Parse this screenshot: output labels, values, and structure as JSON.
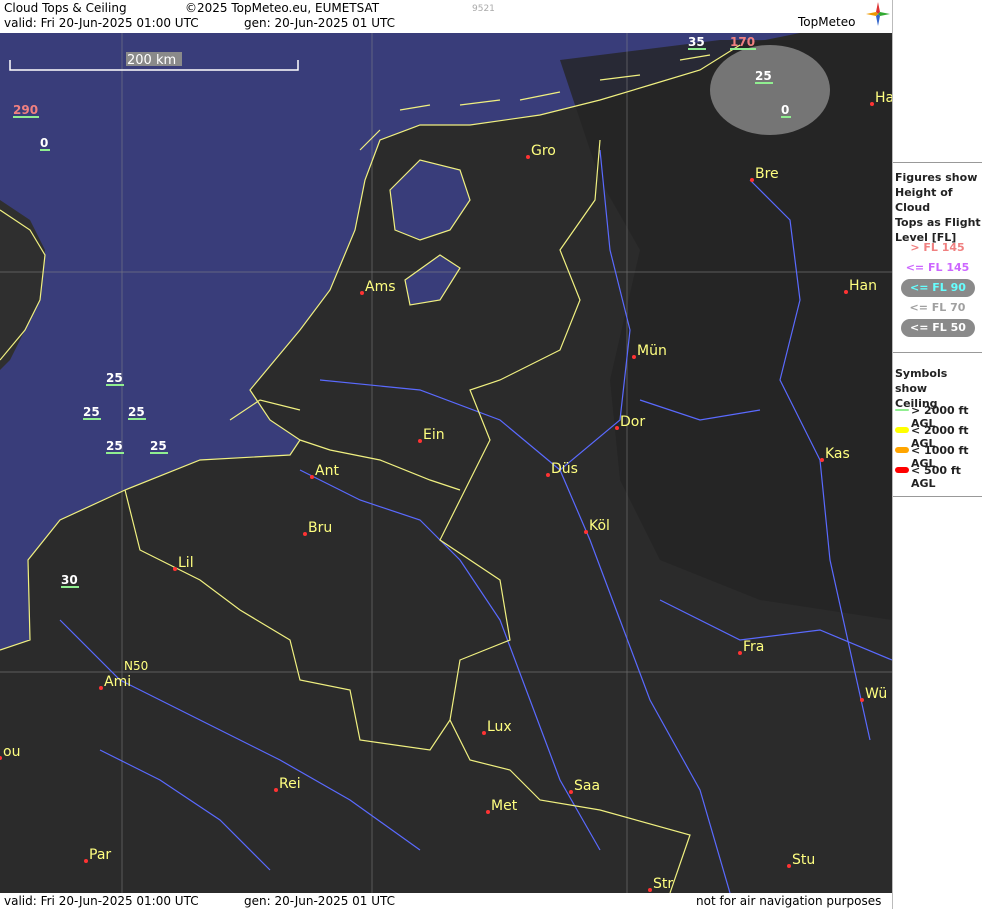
{
  "header": {
    "title": "Cloud Tops & Ceiling",
    "copyright": "©2025 TopMeteo.eu, EUMETSAT",
    "code": "9521",
    "valid": "valid:  Fri  20-Jun-2025  01:00 UTC",
    "gen": "gen: 20-Jun-2025 01 UTC",
    "logo": "TopMeteo"
  },
  "footer": {
    "valid": "valid:  Fri  20-Jun-2025  01:00 UTC",
    "gen": "gen: 20-Jun-2025 01 UTC",
    "disclaimer": "not for air navigation purposes"
  },
  "scale_bar": {
    "label": "200 km"
  },
  "grid_label": "N50",
  "cities": [
    {
      "name": "Gro"
    },
    {
      "name": "Bre"
    },
    {
      "name": "Ha"
    },
    {
      "name": "Ams"
    },
    {
      "name": "Han"
    },
    {
      "name": "Mün"
    },
    {
      "name": "Dor"
    },
    {
      "name": "Ein"
    },
    {
      "name": "Ant"
    },
    {
      "name": "Düs"
    },
    {
      "name": "Kas"
    },
    {
      "name": "Bru"
    },
    {
      "name": "Köl"
    },
    {
      "name": "Lil"
    },
    {
      "name": "Fra"
    },
    {
      "name": "Ami"
    },
    {
      "name": "Wü"
    },
    {
      "name": "Lux"
    },
    {
      "name": "ou"
    },
    {
      "name": "Rei"
    },
    {
      "name": "Saa"
    },
    {
      "name": "Met"
    },
    {
      "name": "Par"
    },
    {
      "name": "Stu"
    },
    {
      "name": "Str"
    }
  ],
  "cloud_tops": [
    {
      "value": "35",
      "level": "le90"
    },
    {
      "value": "170",
      "level": "gt145"
    },
    {
      "value": "25",
      "level": "le90"
    },
    {
      "value": "0",
      "level": "le90"
    },
    {
      "value": "290",
      "level": "gt145"
    },
    {
      "value": "0",
      "level": "le90"
    },
    {
      "value": "25",
      "level": "le90"
    },
    {
      "value": "25",
      "level": "le90"
    },
    {
      "value": "25",
      "level": "le90"
    },
    {
      "value": "25",
      "level": "le90"
    },
    {
      "value": "25",
      "level": "le90"
    },
    {
      "value": "30",
      "level": "le90"
    }
  ],
  "legend": {
    "title_lines": [
      "Figures show",
      "Height of Cloud",
      "Tops as Flight",
      "Level  [FL]"
    ],
    "levels": [
      {
        "label": "> FL 145",
        "color": "#f08080"
      },
      {
        "label": "<= FL 145",
        "color": "#cc66ff"
      },
      {
        "label": "<= FL 90",
        "color": "#66ffff"
      },
      {
        "label": "<= FL 70",
        "color": "#a0a0a0"
      },
      {
        "label": "<= FL 50",
        "color": "#ffffff"
      }
    ],
    "symbols_title": [
      "Symbols show",
      "Ceiling"
    ],
    "symbols": [
      {
        "label": "> 2000 ft AGL",
        "color": "#90ee90"
      },
      {
        "label": "< 2000 ft AGL",
        "color": "#ffff00"
      },
      {
        "label": "< 1000 ft AGL",
        "color": "#ffa500"
      },
      {
        "label": "< 500 ft AGL",
        "color": "#ff0000"
      }
    ]
  },
  "colors": {
    "land": "#2b2b2b",
    "sea": "#393d7a",
    "border": "#f0f080",
    "river": "#5a6aff",
    "label": "#ffff80"
  }
}
